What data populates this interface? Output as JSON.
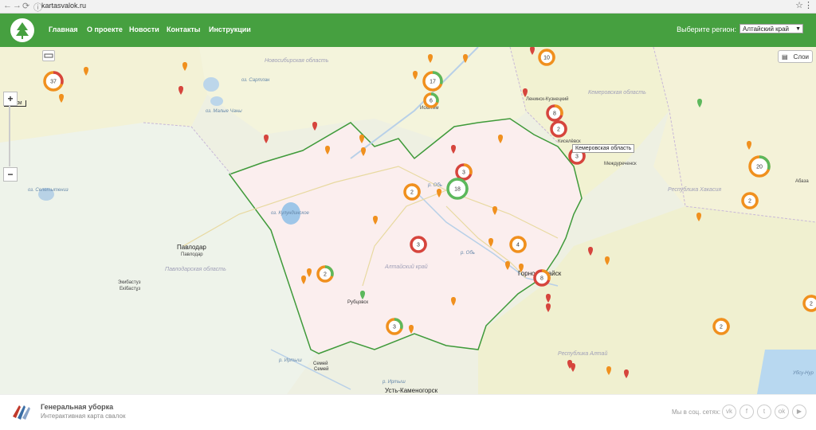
{
  "browser": {
    "url": "kartasvalok.ru"
  },
  "header": {
    "nav": [
      "Главная",
      "О проекте",
      "Новости",
      "Контакты",
      "Инструкции"
    ],
    "region_label": "Выберите регион:",
    "region_value": "Алтайский край"
  },
  "map": {
    "scale_label": "60 км",
    "layers_label": "Слои",
    "zoom_in": "+",
    "zoom_out": "−",
    "tooltip": "Кемеровская область",
    "labels": {
      "novosibirsk": "Новосибирская область",
      "kemerovo": "Кемеровская область",
      "pavlodar_obl": "Павлодарская область",
      "altai_krai": "Алтайский край",
      "khakasia": "Республика Хакасия",
      "altai_rep": "Республика Алтай",
      "pavlodar": "Павлодар",
      "pavlodar2": "Павлодар",
      "ekibastuz": "Экибастуз",
      "ekibastuz2": "Екібастұз",
      "rubtsovsk": "Рубцовск",
      "semey": "Семей",
      "semey2": "Семей",
      "ust_kamenogorsk": "Усть-Каменогорск",
      "gorno_altaysk": "Горно-Алтайск",
      "iskitim": "Искитим",
      "kiselevsk": "Киселёвск",
      "mezhdurechensk": "Междуреченск",
      "lake_kulunda": "оз. Кулундинское",
      "lake_chany": "оз. Малые Чаны",
      "lake_sartlan": "оз. Сартлан",
      "lake_seletyteniz": "оз. Селетытениз",
      "river_ob": "р. Обь",
      "river_irtysh": "р. Иртыш",
      "river_irtysh2": "р. Иртыш",
      "river_chumysh": "р. Обь",
      "leninsk": "Ленинск-Кузнецкий",
      "ubsu_nur": "Убсу-Нур",
      "abaza": "Абаза"
    },
    "clusters": [
      "37",
      "17",
      "6",
      "10",
      "8",
      "2",
      "3",
      "3",
      "18",
      "2",
      "3",
      "4",
      "8",
      "2",
      "3",
      "20",
      "2",
      "2",
      "2"
    ]
  },
  "footer": {
    "title": "Генеральная уборка",
    "subtitle": "Интерактивная карта свалок",
    "social_label": "Мы в соц. сетях:",
    "social": [
      "vk",
      "fb",
      "tw",
      "ok",
      "yt"
    ]
  }
}
